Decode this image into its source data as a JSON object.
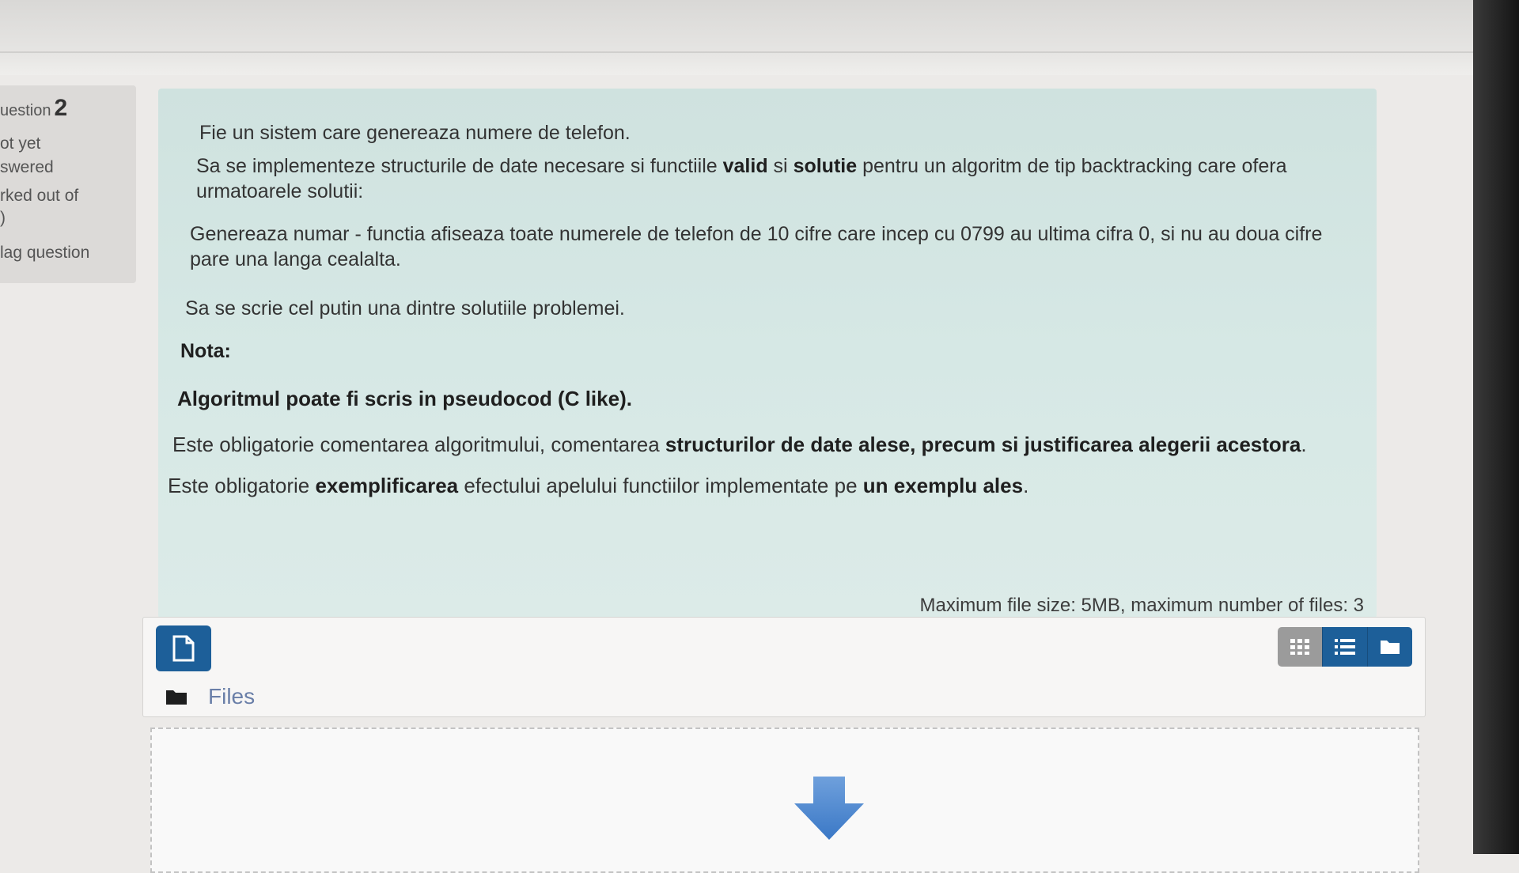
{
  "question_info": {
    "label": "uestion",
    "number": "2",
    "state_line1": "ot yet",
    "state_line2": "swered",
    "grade_line1": "rked out of",
    "grade_line2": ")",
    "flag_label": "lag question"
  },
  "question": {
    "p1": "Fie un sistem care genereaza numere de telefon.",
    "p2_a": "Sa se implementeze structurile de date necesare si functiile ",
    "p2_b1": "valid",
    "p2_c": " si ",
    "p2_b2": "solutie",
    "p2_d": " pentru un algoritm de tip backtracking care ofera urmatoarele solutii:",
    "p3": "Genereaza numar - functia afiseaza toate numerele de telefon de 10 cifre care incep cu 0799 au ultima cifra 0, si nu au doua cifre pare una langa cealalta.",
    "p3_box": "",
    "p4": "Sa se scrie cel putin una dintre solutiile problemei.",
    "nota": "Nota:",
    "algoritm": "Algoritmul poate fi scris in pseudocod (C like).",
    "p5_a": "Este obligatorie comentarea algoritmului, comentarea ",
    "p5_b": "structurilor de date alese, precum si justificarea alegerii acestora",
    "p5_c": ".",
    "p6_a": "Este obligatorie ",
    "p6_b": "exemplificarea",
    "p6_c": " efectului apelului functiilor implementate pe ",
    "p6_d": "un exemplu ales",
    "p6_e": "."
  },
  "filemanager": {
    "max_size_text": "Maximum file size: 5MB, maximum number of files: 3",
    "path_label": "Files"
  },
  "colors": {
    "accent": "#1d5f99",
    "panel": "#d6e8e5"
  }
}
